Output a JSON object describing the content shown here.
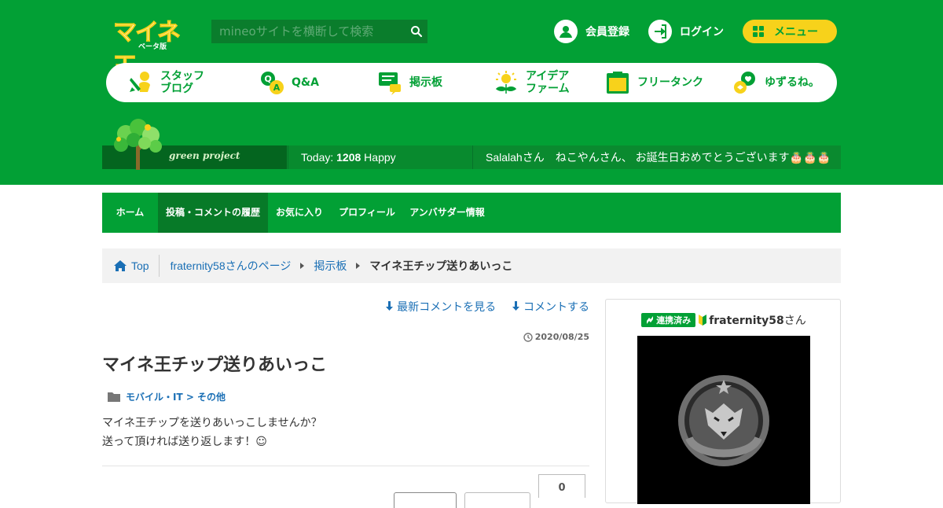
{
  "header": {
    "logo_title": "マイネ王",
    "logo_sub": "ベータ版",
    "search_placeholder": "mineoサイトを横断して検索",
    "register_label": "会員登録",
    "login_label": "ログイン",
    "menu_label": "メニュー"
  },
  "nav": [
    {
      "label": "スタッフ\nブログ",
      "icon": "staff-blog-icon"
    },
    {
      "label": "Q&A",
      "icon": "qa-icon"
    },
    {
      "label": "掲示板",
      "icon": "board-icon"
    },
    {
      "label": "アイデア\nファーム",
      "icon": "idea-icon"
    },
    {
      "label": "フリータンク",
      "icon": "tank-icon"
    },
    {
      "label": "ゆずるね。",
      "icon": "yuzurune-icon"
    }
  ],
  "green_project": {
    "logo_text": "green project",
    "today_prefix": "Today: ",
    "today_count": "1208",
    "today_suffix": " Happy",
    "message": "Salalahさん　ねこやんさん、 お誕生日おめでとうございます🎂🎂🎂"
  },
  "subnav": [
    "ホーム",
    "投稿・コメントの履歴",
    "お気に入り",
    "プロフィール",
    "アンバサダー情報"
  ],
  "breadcrumb": {
    "top": "Top",
    "user_page": "fraternity58さんのページ",
    "board": "掲示板",
    "current": "マイネ王チップ送りあいっこ"
  },
  "post": {
    "link_latest": "最新コメントを見る",
    "link_comment": "コメントする",
    "date": "2020/08/25",
    "title": "マイネ王チップ送りあいっこ",
    "category": "モバイル・IT > その他",
    "body_line1": "マイネ王チップを送りあいっこしませんか？",
    "body_line2": "送って頂ければ送り返します！☺",
    "count": "0"
  },
  "profile": {
    "badge": "連携済み",
    "name": "fraternity58",
    "suffix": "さん"
  },
  "colors": {
    "brand_green": "#02a035",
    "accent_yellow": "#f7d21b",
    "link_blue": "#1a6fb5"
  }
}
